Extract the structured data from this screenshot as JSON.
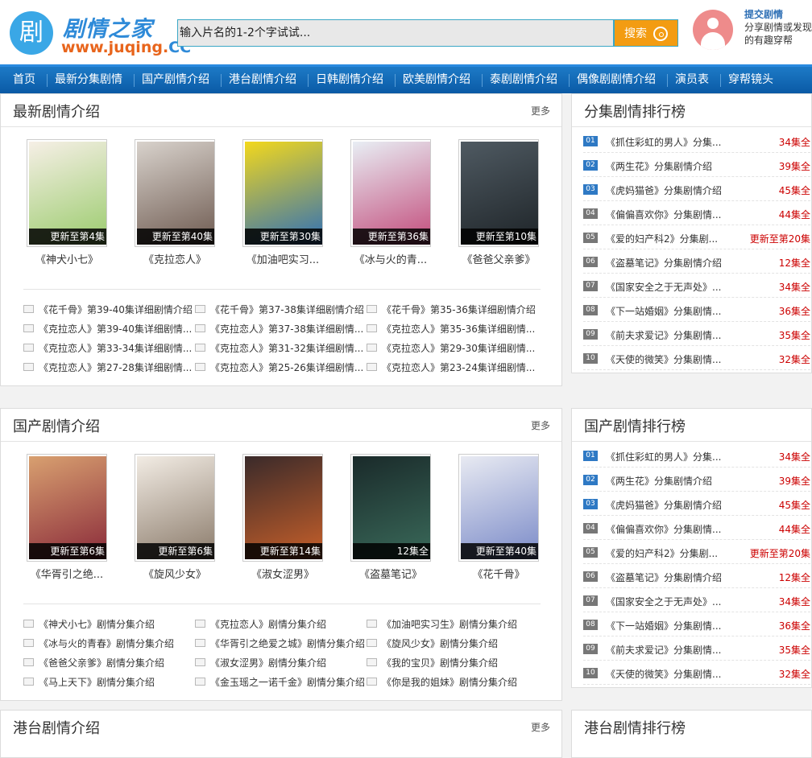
{
  "logo": {
    "glyph": "剧",
    "title": "剧情之家",
    "url_a": "www.juqing.",
    "url_b": "CC"
  },
  "search": {
    "placeholder": "输入片名的1-2个字试试...",
    "button": "搜索"
  },
  "user": {
    "submit": "提交剧情",
    "desc": "分享剧情或发现的有趣穿帮"
  },
  "nav": [
    "首页",
    "最新分集剧情",
    "国产剧情介绍",
    "港台剧情介绍",
    "日韩剧情介绍",
    "欧美剧情介绍",
    "泰剧剧情介绍",
    "偶像剧剧情介绍",
    "演员表",
    "穿帮镜头"
  ],
  "sections": [
    {
      "title": "最新剧情介绍",
      "more": "更多",
      "posters": [
        {
          "caption": "更新至第4集",
          "title": "《神犬小七》",
          "colors": [
            "#f6efe6",
            "#9acb6c"
          ]
        },
        {
          "caption": "更新至第40集",
          "title": "《克拉恋人》",
          "colors": [
            "#d8d2cc",
            "#6e5a50"
          ]
        },
        {
          "caption": "更新至第30集",
          "title": "《加油吧实习...",
          "colors": [
            "#f3d81c",
            "#2e6fb8"
          ]
        },
        {
          "caption": "更新至第36集",
          "title": "《冰与火的青...",
          "colors": [
            "#e8eef4",
            "#c24a7a"
          ]
        },
        {
          "caption": "更新至第10集",
          "title": "《爸爸父亲爹》",
          "colors": [
            "#4f5a62",
            "#1e2428"
          ]
        }
      ],
      "links": [
        [
          "《花千骨》第39-40集详细剧情介绍",
          "《花千骨》第37-38集详细剧情介绍",
          "《花千骨》第35-36集详细剧情介绍"
        ],
        [
          "《克拉恋人》第39-40集详细剧情...",
          "《克拉恋人》第37-38集详细剧情...",
          "《克拉恋人》第35-36集详细剧情..."
        ],
        [
          "《克拉恋人》第33-34集详细剧情...",
          "《克拉恋人》第31-32集详细剧情...",
          "《克拉恋人》第29-30集详细剧情..."
        ],
        [
          "《克拉恋人》第27-28集详细剧情...",
          "《克拉恋人》第25-26集详细剧情...",
          "《克拉恋人》第23-24集详细剧情..."
        ]
      ]
    },
    {
      "title": "国产剧情介绍",
      "more": "更多",
      "posters": [
        {
          "caption": "更新至第6集",
          "title": "《华胥引之绝...",
          "colors": [
            "#d8a070",
            "#8a2a3a"
          ]
        },
        {
          "caption": "更新至第6集",
          "title": "《旋风少女》",
          "colors": [
            "#f2ece4",
            "#8a7a6a"
          ]
        },
        {
          "caption": "更新至第14集",
          "title": "《淑女涩男》",
          "colors": [
            "#3a2a2a",
            "#c8602a"
          ]
        },
        {
          "caption": "12集全",
          "title": "《盗墓笔记》",
          "colors": [
            "#1a2a2a",
            "#3a6a5a"
          ]
        },
        {
          "caption": "更新至第40集",
          "title": "《花千骨》",
          "colors": [
            "#e8eaf2",
            "#7a8ac8"
          ]
        }
      ],
      "links": [
        [
          "《神犬小七》剧情分集介绍",
          "《克拉恋人》剧情分集介绍",
          "《加油吧实习生》剧情分集介绍"
        ],
        [
          "《冰与火的青春》剧情分集介绍",
          "《华胥引之绝爱之城》剧情分集介绍",
          "《旋风少女》剧情分集介绍"
        ],
        [
          "《爸爸父亲爹》剧情分集介绍",
          "《淑女涩男》剧情分集介绍",
          "《我的宝贝》剧情分集介绍"
        ],
        [
          "《马上天下》剧情分集介绍",
          "《金玉瑶之一诺千金》剧情分集介绍",
          "《你是我的姐妹》剧情分集介绍"
        ]
      ]
    },
    {
      "title": "港台剧情介绍",
      "more": "更多"
    }
  ],
  "rankings": [
    {
      "title": "分集剧情排行榜"
    },
    {
      "title": "国产剧情排行榜"
    },
    {
      "title": "港台剧情排行榜"
    }
  ],
  "rank_items": [
    {
      "num": "01",
      "name": "《抓住彩虹的男人》分集...",
      "ep": "34集全"
    },
    {
      "num": "02",
      "name": "《两生花》分集剧情介绍",
      "ep": "39集全"
    },
    {
      "num": "03",
      "name": "《虎妈猫爸》分集剧情介绍",
      "ep": "45集全"
    },
    {
      "num": "04",
      "name": "《偏偏喜欢你》分集剧情...",
      "ep": "44集全"
    },
    {
      "num": "05",
      "name": "《爱的妇产科2》分集剧...",
      "ep": "更新至第20集"
    },
    {
      "num": "06",
      "name": "《盗墓笔记》分集剧情介绍",
      "ep": "12集全"
    },
    {
      "num": "07",
      "name": "《国家安全之于无声处》...",
      "ep": "34集全"
    },
    {
      "num": "08",
      "name": "《下一站婚姻》分集剧情...",
      "ep": "36集全"
    },
    {
      "num": "09",
      "name": "《前夫求爱记》分集剧情...",
      "ep": "35集全"
    },
    {
      "num": "10",
      "name": "《天使的微笑》分集剧情...",
      "ep": "32集全"
    }
  ]
}
